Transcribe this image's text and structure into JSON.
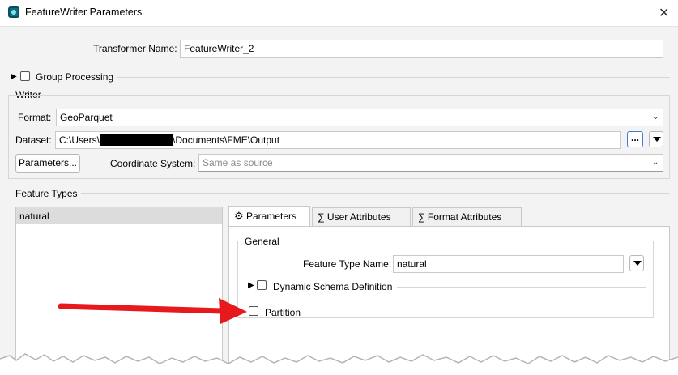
{
  "window": {
    "title": "FeatureWriter Parameters",
    "close_label": "✕"
  },
  "transformer": {
    "label": "Transformer Name:",
    "value": "FeatureWriter_2"
  },
  "group_processing": {
    "label": "Group Processing",
    "checked": false
  },
  "writer": {
    "section_label": "Writer",
    "format_label": "Format:",
    "format_value": "GeoParquet",
    "dataset_label": "Dataset:",
    "dataset_prefix": "C:\\Users\\",
    "dataset_suffix": "\\Documents\\FME\\Output",
    "browse_label": "...",
    "parameters_button": "Parameters...",
    "coord_label": "Coordinate System:",
    "coord_value": "Same as source"
  },
  "feature_types": {
    "section_label": "Feature Types",
    "items": [
      "natural"
    ]
  },
  "tabs": [
    {
      "label": "Parameters",
      "icon": "gear-icon",
      "active": true
    },
    {
      "label": "User Attributes",
      "icon": "sigma-icon",
      "active": false
    },
    {
      "label": "Format Attributes",
      "icon": "sigma-icon",
      "active": false
    }
  ],
  "general": {
    "section_label": "General",
    "feature_type_name_label": "Feature Type Name:",
    "feature_type_name_value": "natural",
    "dynamic_schema_label": "Dynamic Schema Definition",
    "partition_label": "Partition"
  },
  "annotation": {
    "arrow_color": "#e8191c"
  },
  "colors": {
    "accent": "#3c7fd6",
    "app_icon": "#0f6e7e"
  }
}
